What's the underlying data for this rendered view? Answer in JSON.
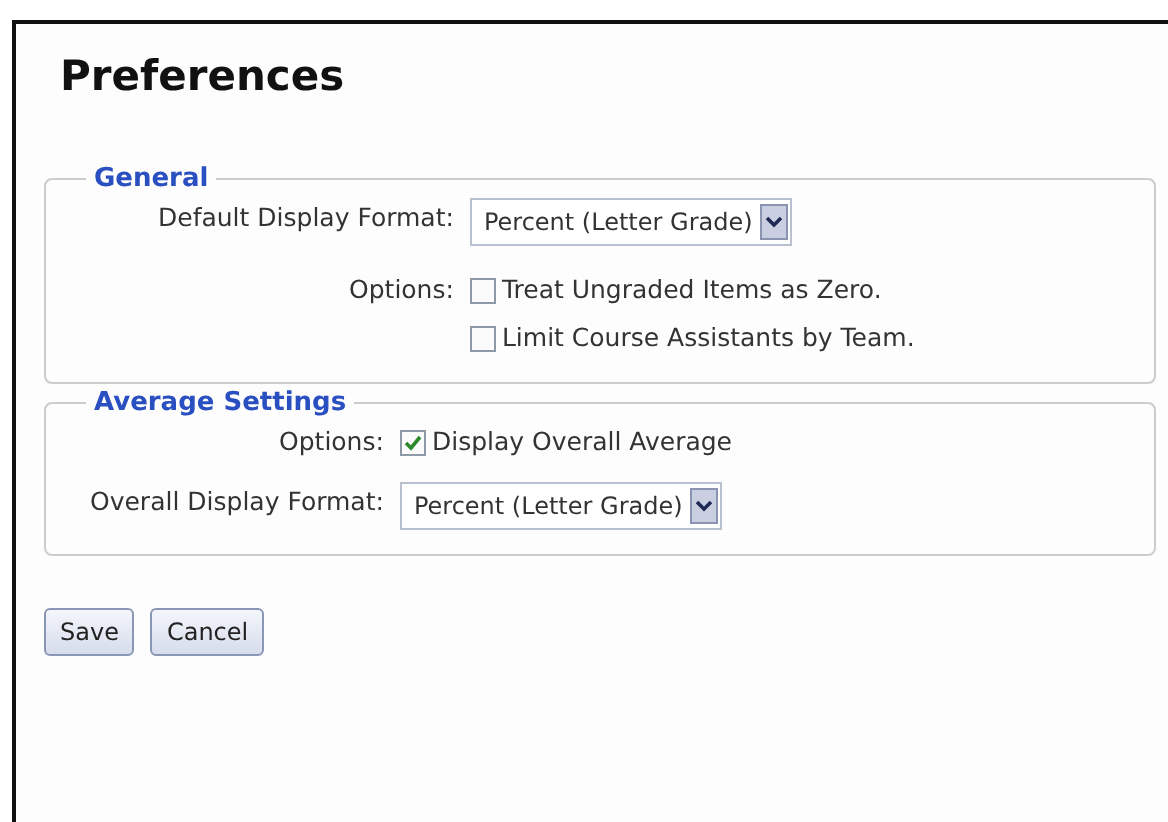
{
  "title": "Preferences",
  "sections": [
    {
      "legend": "General",
      "rows": [
        {
          "kind": "select",
          "label": "Default Display Format:",
          "value": "Percent (Letter Grade)"
        },
        {
          "kind": "checkboxes",
          "label": "Options:",
          "options": [
            {
              "label": "Treat Ungraded Items as Zero.",
              "checked": false
            },
            {
              "label": "Limit Course Assistants by Team.",
              "checked": false
            }
          ]
        }
      ]
    },
    {
      "legend": "Average Settings",
      "rows": [
        {
          "kind": "checkboxes",
          "label": "Options:",
          "options": [
            {
              "label": "Display Overall Average",
              "checked": true
            }
          ]
        },
        {
          "kind": "select",
          "label": "Overall Display Format:",
          "value": "Percent (Letter Grade)"
        }
      ]
    }
  ],
  "buttons": [
    "Save",
    "Cancel"
  ]
}
